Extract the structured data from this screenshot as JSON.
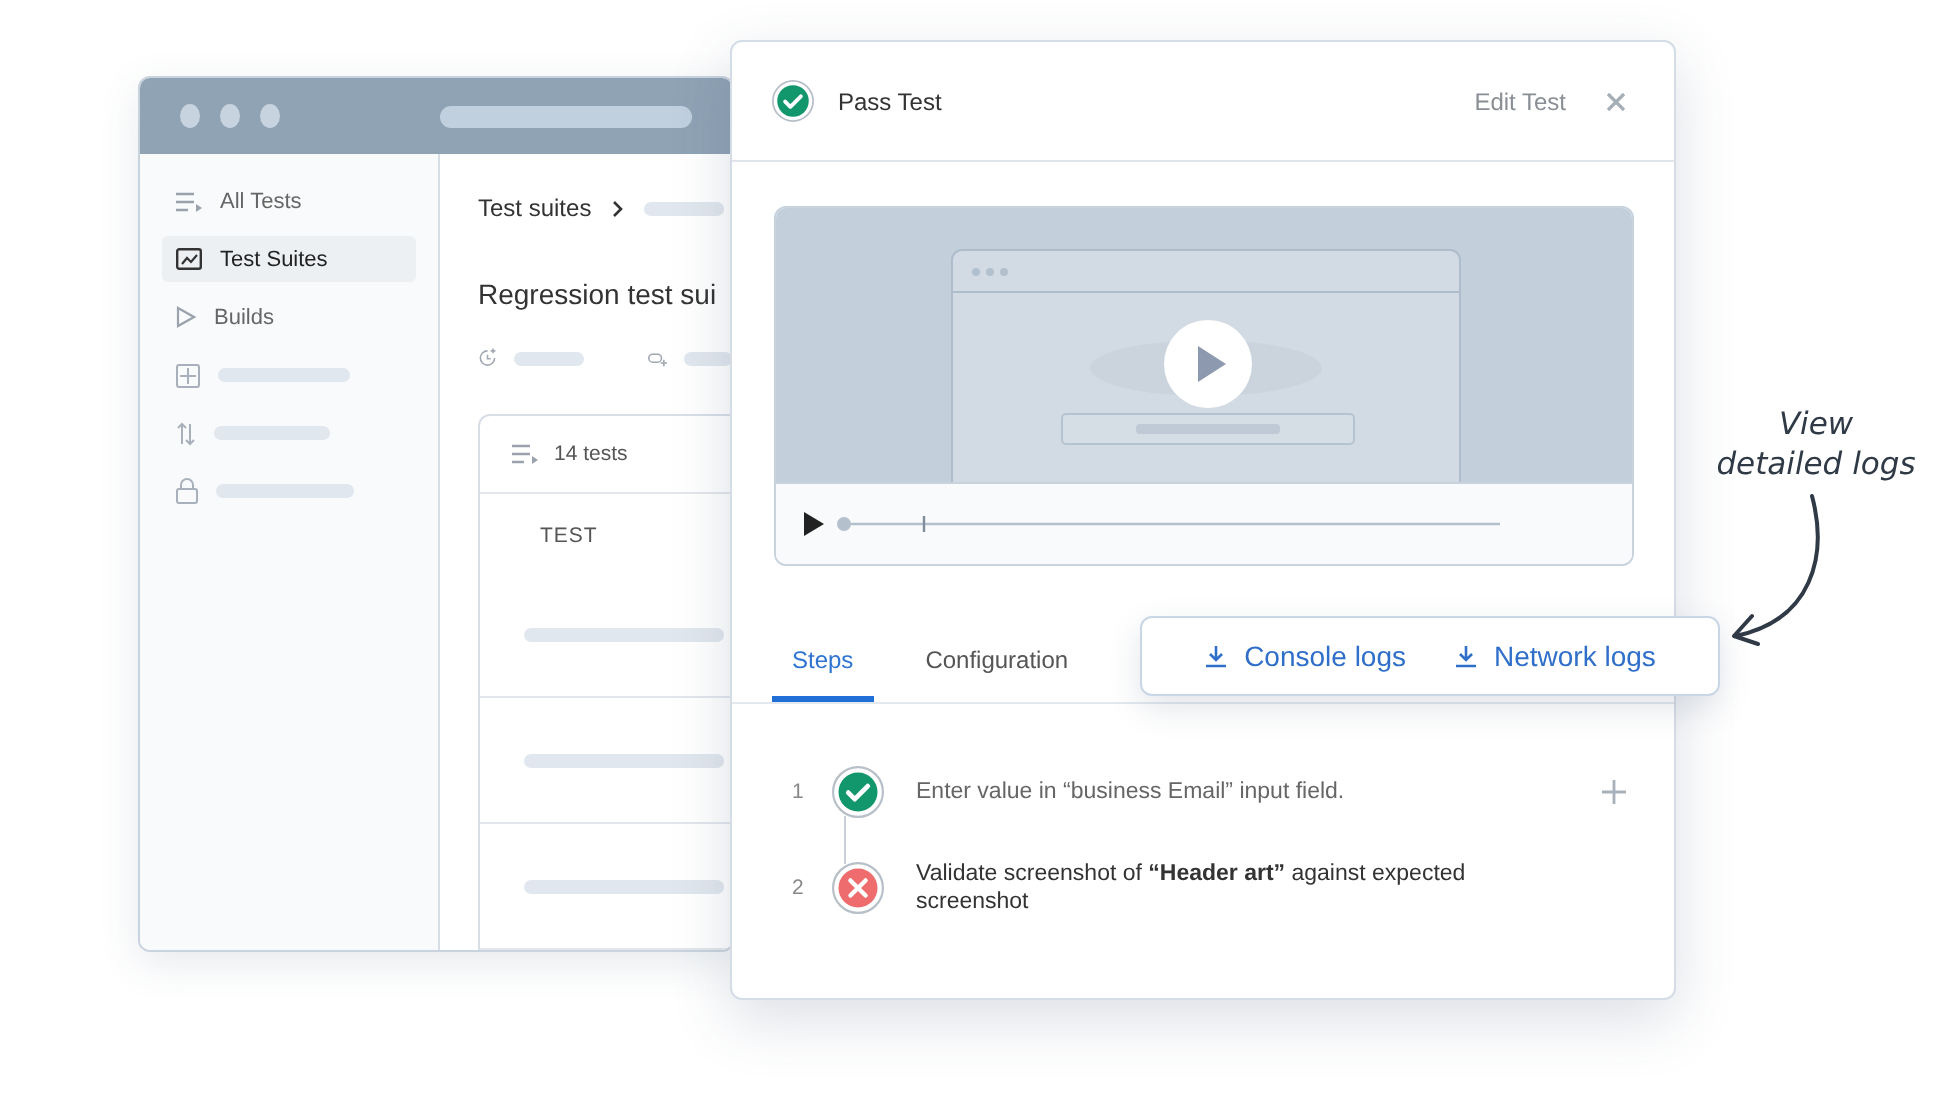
{
  "back_window": {
    "sidebar": {
      "items": [
        {
          "label": "All Tests",
          "selected": false
        },
        {
          "label": "Test Suites",
          "selected": true
        },
        {
          "label": "Builds",
          "selected": false
        }
      ]
    },
    "breadcrumb": "Test suites",
    "title": "Regression test sui",
    "table": {
      "count": "14 tests",
      "columns": [
        "TEST"
      ]
    }
  },
  "test_card": {
    "passed": true,
    "title": "Pass Test",
    "edit_label": "Edit Test",
    "video": {
      "kind": "picture"
    },
    "tabs": [
      {
        "label": "Steps",
        "selected": true
      },
      {
        "label": "Configuration",
        "selected": false
      }
    ],
    "log_buttons": [
      "Console logs",
      "Network logs"
    ],
    "steps": [
      {
        "number": "1",
        "passed": true,
        "text": "Enter value in “business Email” input field.",
        "addable": true
      },
      {
        "number": "2",
        "passed": false,
        "text": "Validate screenshot of **“Header art”** against expected screenshot",
        "addable": false
      }
    ]
  },
  "annotation": [
    "View",
    "detailed logs"
  ]
}
